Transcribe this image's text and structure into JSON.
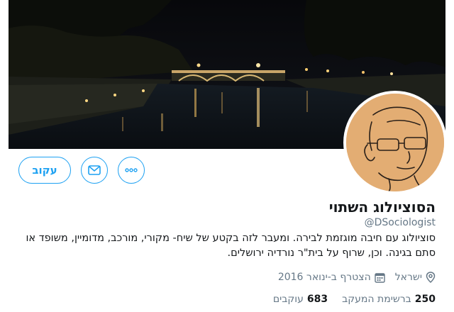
{
  "profile": {
    "name": "הסוציולוג השתוי",
    "handle": "@DSociologist",
    "bio": "סוציולוג עם חיבה מוגזמת לבירה. ומעבר לזה בקטע של שיח- מקורי, מורכב, מדומיין, משופד או סתם בגינה. וכן, שרוף על בית\"ר נורדיה ירושלים.",
    "location": "ישראל",
    "joined": "הצטרף ב-ינואר 2016",
    "following_count": "250",
    "following_label": "ברשימת המעקב",
    "followers_count": "683",
    "followers_label": "עוקבים"
  },
  "actions": {
    "follow_label": "עקוב"
  },
  "icons": {
    "message": "envelope-icon",
    "more": "more-dots-icon",
    "location": "location-pin-icon",
    "joined": "calendar-icon"
  },
  "colors": {
    "accent": "#1da1f2",
    "secondary_text": "#657786",
    "avatar_bg": "#e3ad73"
  }
}
